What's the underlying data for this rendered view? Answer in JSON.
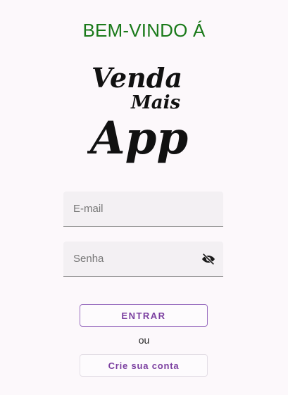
{
  "welcome_title": "BEM-VINDO Á",
  "logo": {
    "line1": "Venda",
    "line2": "Mais",
    "line3": "App"
  },
  "form": {
    "email_placeholder": "E-mail",
    "password_placeholder": "Senha",
    "password_toggle_icon": "eye-off-icon"
  },
  "actions": {
    "enter_label": "ENTRAR",
    "or_label": "ou",
    "create_account_label": "Crie sua conta"
  },
  "colors": {
    "title": "#1a7a1a",
    "accent": "#7b3fa0",
    "background": "#fcf8fb"
  }
}
